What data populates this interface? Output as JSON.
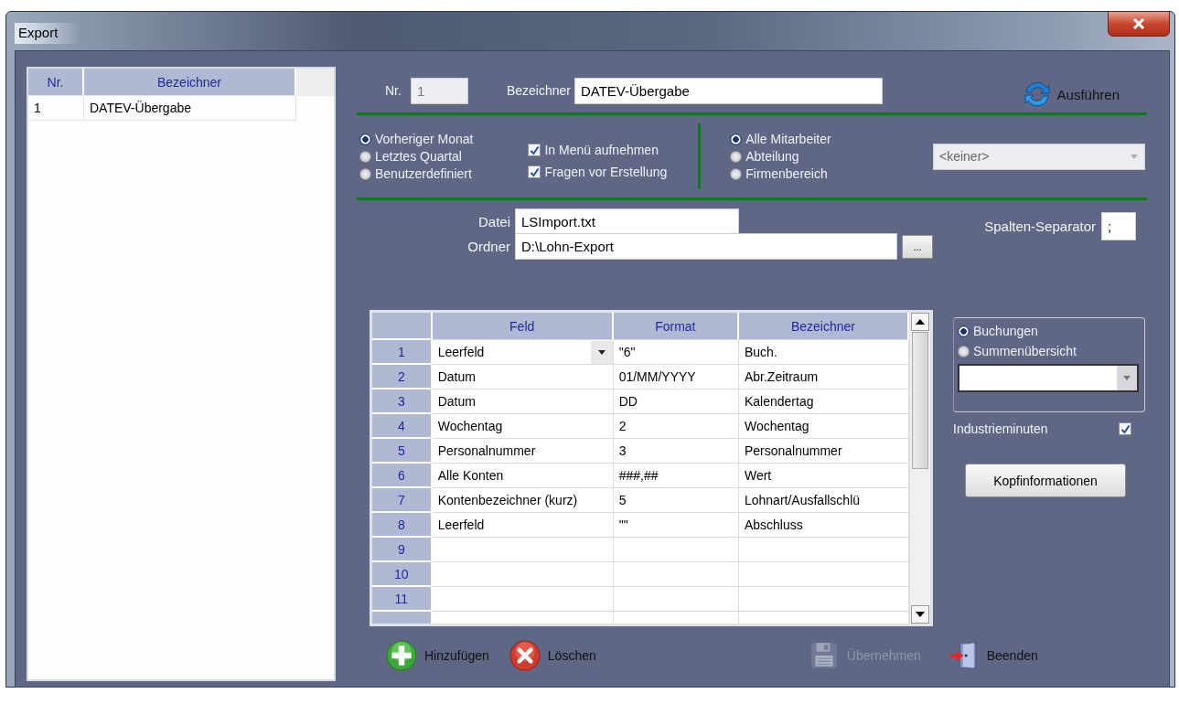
{
  "window": {
    "title": "Export"
  },
  "list": {
    "columns": [
      "Nr.",
      "Bezeichner"
    ],
    "rows": [
      {
        "cells": [
          "1",
          "DATEV-Übergabe"
        ]
      }
    ]
  },
  "header": {
    "nr_label": "Nr.",
    "nr_value": "1",
    "nr_disabled": true,
    "name_label": "Bezeichner",
    "name_value": "DATEV-Übergabe",
    "run_button": "Ausführen"
  },
  "period_options": [
    {
      "label": "Vorheriger Monat",
      "selected": true
    },
    {
      "label": "Letztes Quartal",
      "selected": false
    },
    {
      "label": "Benutzerdefiniert",
      "selected": false
    }
  ],
  "checkboxes": [
    {
      "label": "In Menü aufnehmen",
      "checked": true
    },
    {
      "label": "Fragen vor Erstellung",
      "checked": true
    }
  ],
  "employee_options": [
    {
      "label": "Alle Mitarbeiter",
      "selected": true
    },
    {
      "label": "Abteilung",
      "selected": false
    },
    {
      "label": "Firmenbereich",
      "selected": false
    }
  ],
  "department_select": {
    "value": "<keiner>",
    "disabled": true
  },
  "file": {
    "label": "Datei",
    "value": "LSImport.txt"
  },
  "folder": {
    "label": "Ordner",
    "value": "D:\\Lohn-Export",
    "browse": "..."
  },
  "separator": {
    "label": "Spalten-Separator",
    "value": ";"
  },
  "table": {
    "columns": [
      "Feld",
      "Format",
      "Bezeichner"
    ],
    "rows": [
      {
        "nr": "1",
        "cells": [
          "Leerfeld",
          "\"6\"",
          "Buch."
        ],
        "dropdown": true
      },
      {
        "nr": "2",
        "cells": [
          "Datum",
          "01/MM/YYYY",
          "Abr.Zeitraum"
        ],
        "dropdown": false
      },
      {
        "nr": "3",
        "cells": [
          "Datum",
          "DD",
          "Kalendertag"
        ],
        "dropdown": false
      },
      {
        "nr": "4",
        "cells": [
          "Wochentag",
          "2",
          "Wochentag"
        ],
        "dropdown": false
      },
      {
        "nr": "5",
        "cells": [
          "Personalnummer",
          "3",
          "Personalnummer"
        ],
        "dropdown": false
      },
      {
        "nr": "6",
        "cells": [
          "Alle Konten",
          "###,##",
          "Wert"
        ],
        "dropdown": false
      },
      {
        "nr": "7",
        "cells": [
          "Kontenbezeichner (kurz)",
          "5",
          "Lohnart/Ausfallschlü"
        ],
        "dropdown": false
      },
      {
        "nr": "8",
        "cells": [
          "Leerfeld",
          "\"\"",
          "Abschluss"
        ],
        "dropdown": false
      },
      {
        "nr": "9",
        "dropdown": false
      },
      {
        "nr": "10",
        "dropdown": false
      },
      {
        "nr": "11",
        "dropdown": false
      }
    ]
  },
  "output_options": [
    {
      "label": "Buchungen",
      "selected": true
    },
    {
      "label": "Summenübersicht",
      "selected": false
    }
  ],
  "industry_minutes": {
    "label": "Industrieminuten",
    "checked": true
  },
  "header_info_button": "Kopfinformationen",
  "toolbar": [
    {
      "label": "Hinzufügen",
      "kind": "add",
      "disabled": false
    },
    {
      "label": "Löschen",
      "kind": "delete",
      "disabled": false
    },
    {
      "label": "Übernehmen",
      "kind": "save",
      "disabled": true
    },
    {
      "label": "Beenden",
      "kind": "exit",
      "disabled": false
    }
  ]
}
